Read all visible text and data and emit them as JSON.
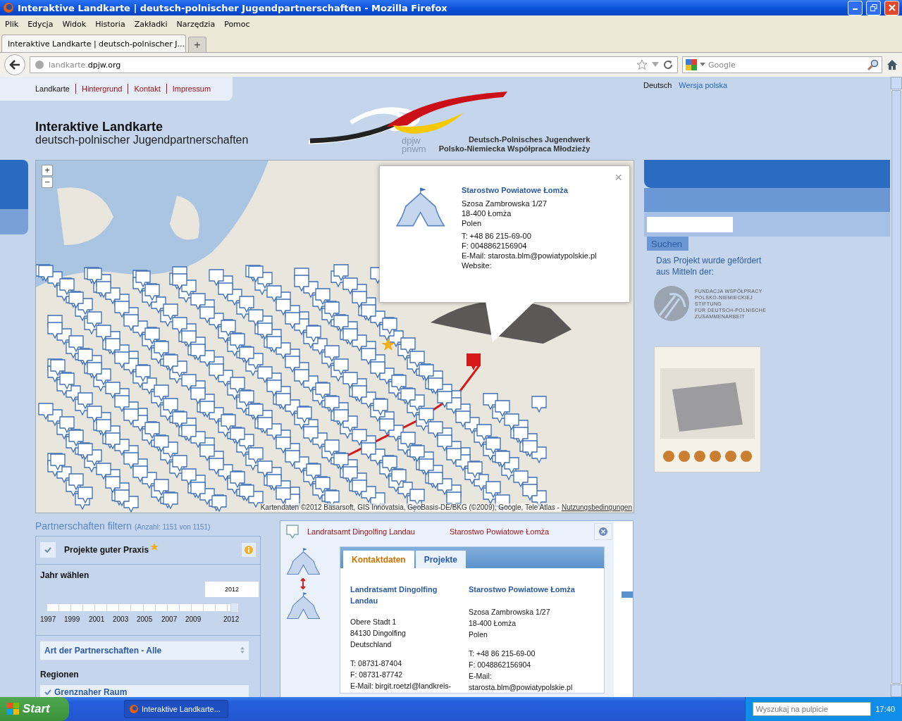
{
  "window": {
    "title": "Interaktive Landkarte | deutsch-polnischer Jugendpartnerschaften - Mozilla Firefox"
  },
  "menu": [
    "Plik",
    "Edycja",
    "Widok",
    "Historia",
    "Zakładki",
    "Narzędzia",
    "Pomoc"
  ],
  "tabs": [
    {
      "label": "Interaktive Landkarte | deutsch-polnischer J...",
      "selected": true
    }
  ],
  "new_tab": "+",
  "address": {
    "prefix": "landkarte.",
    "host": "dpjw.org"
  },
  "search": {
    "placeholder": "Google"
  },
  "site_nav": [
    {
      "label": "Landkarte",
      "selected": true
    },
    {
      "label": "Hintergrund",
      "selected": false
    },
    {
      "label": "Kontakt",
      "selected": false
    },
    {
      "label": "Impressum",
      "selected": false
    }
  ],
  "languages": [
    {
      "label": "Deutsch",
      "selected": true
    },
    {
      "label": "Wersja polska",
      "selected": false
    }
  ],
  "site_title": "Interaktive Landkarte",
  "site_subtitle": "deutsch-polnischer Jugendpartnerschaften",
  "logo": {
    "mark": [
      "dpjw",
      "pnwm"
    ],
    "lines": [
      "Deutsch-Polnisches Jugendwerk",
      "Polsko-Niemiecka Współpraca Młodzieży"
    ]
  },
  "map": {
    "zoom": [
      "+",
      "−"
    ],
    "attribution": "Kartendaten ©2012 Basarsoft, GIS Innovatsia, GeoBasis-DE/BKG (©2009), Google, Tele Atlas -",
    "terms": "Nutzungsbedingungen"
  },
  "popup": {
    "title": "Starostwo Powiatowe Łomża",
    "close": "×",
    "address": [
      "Szosa Zambrowska 1/27",
      "18-400 Łomża",
      "Polen"
    ],
    "contact": [
      "T: +48 86 215-69-00",
      "F: 0048862156904",
      "E-Mail: starosta.blm@powiatypolskie.pl",
      "Website:"
    ]
  },
  "filter": {
    "title": "Partnerschaften filtern",
    "count": "(Anzahl: 1151 von 1151)",
    "good_practice": {
      "label": "Projekte guter Praxis",
      "checked": true
    },
    "year": {
      "label": "Jahr wählen",
      "value": "2012",
      "level": 1,
      "ticks": [
        "1997",
        "1999",
        "2001",
        "2003",
        "2005",
        "2007",
        "2009",
        "2012"
      ]
    },
    "type_select": "Art der Partnerschaften - Alle",
    "regions_label": "Regionen",
    "regions": [
      {
        "label": "Grenznaher Raum",
        "checked": true
      }
    ]
  },
  "detail": {
    "partners": [
      "Landratsamt Dingolfing Landau",
      "Starostwo Powiatowe Łomża"
    ],
    "tabs": [
      {
        "label": "Kontaktdaten",
        "selected": true
      },
      {
        "label": "Projekte",
        "selected": false
      }
    ],
    "columns": [
      {
        "title": "Landratsamt Dingolfing Landau",
        "address": [
          "Obere Stadt 1",
          "84130 Dingolfing",
          "Deutschland"
        ],
        "contact": [
          "T: 08731-87404",
          "F: 08731-87742",
          "E-Mail: birgit.roetzl@landkreis-"
        ]
      },
      {
        "title": "Starostwo Powiatowe Łomża",
        "address": [
          "Szosa Zambrowska 1/27",
          "18-400 Łomża",
          "Polen"
        ],
        "contact": [
          "T: +48 86 215-69-00",
          "F: 0048862156904",
          "E-Mail:",
          "starosta.blm@powiatypolskie.pl"
        ]
      }
    ]
  },
  "sidebar": {
    "search_button": "Suchen",
    "funding_text": "Das Projekt wurde gefördert aus Mitteln der:",
    "foundation": [
      "FUNDACJA WSPÓŁPRACY",
      "POLSKO-NIEMIECKIEJ",
      "STIFTUNG",
      "FÜR DEUTSCH-POLNISCHE",
      "ZUSAMMENARBEIT"
    ]
  },
  "taskbar": {
    "start": "Start",
    "window": "Interaktive Landkarte...",
    "search_placeholder": "Wyszukaj na pulpicie",
    "clock": "17:40"
  }
}
